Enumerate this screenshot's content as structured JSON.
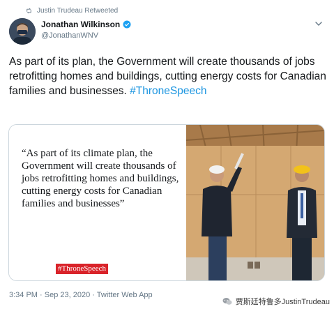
{
  "retweet": {
    "label": "Justin Trudeau Retweeted"
  },
  "author": {
    "display_name": "Jonathan Wilkinson",
    "handle": "@JonathanWNV",
    "verified": true
  },
  "tweet": {
    "text": "As part of its plan, the Government will create thousands of jobs retrofitting homes and buildings, cutting energy costs for Canadian families and businesses. ",
    "hashtag": "#ThroneSpeech"
  },
  "card": {
    "quote": "“As part of its climate plan, the Government will create thousands of jobs retrofitting homes and buildings, cutting energy costs for Canadian families and businesses”",
    "tag": "#ThroneSpeech"
  },
  "meta": {
    "timestamp": "3:34 PM · Sep 23, 2020 · Twitter Web App"
  },
  "watermark": {
    "label": "贾斯廷特鲁多JustinTrudeau"
  },
  "colors": {
    "accent": "#1b95e0",
    "tag_bg": "#d9232a",
    "muted": "#657786"
  },
  "icons": [
    "retweet-icon",
    "verified-icon",
    "chevron-down-icon",
    "wechat-icon"
  ]
}
